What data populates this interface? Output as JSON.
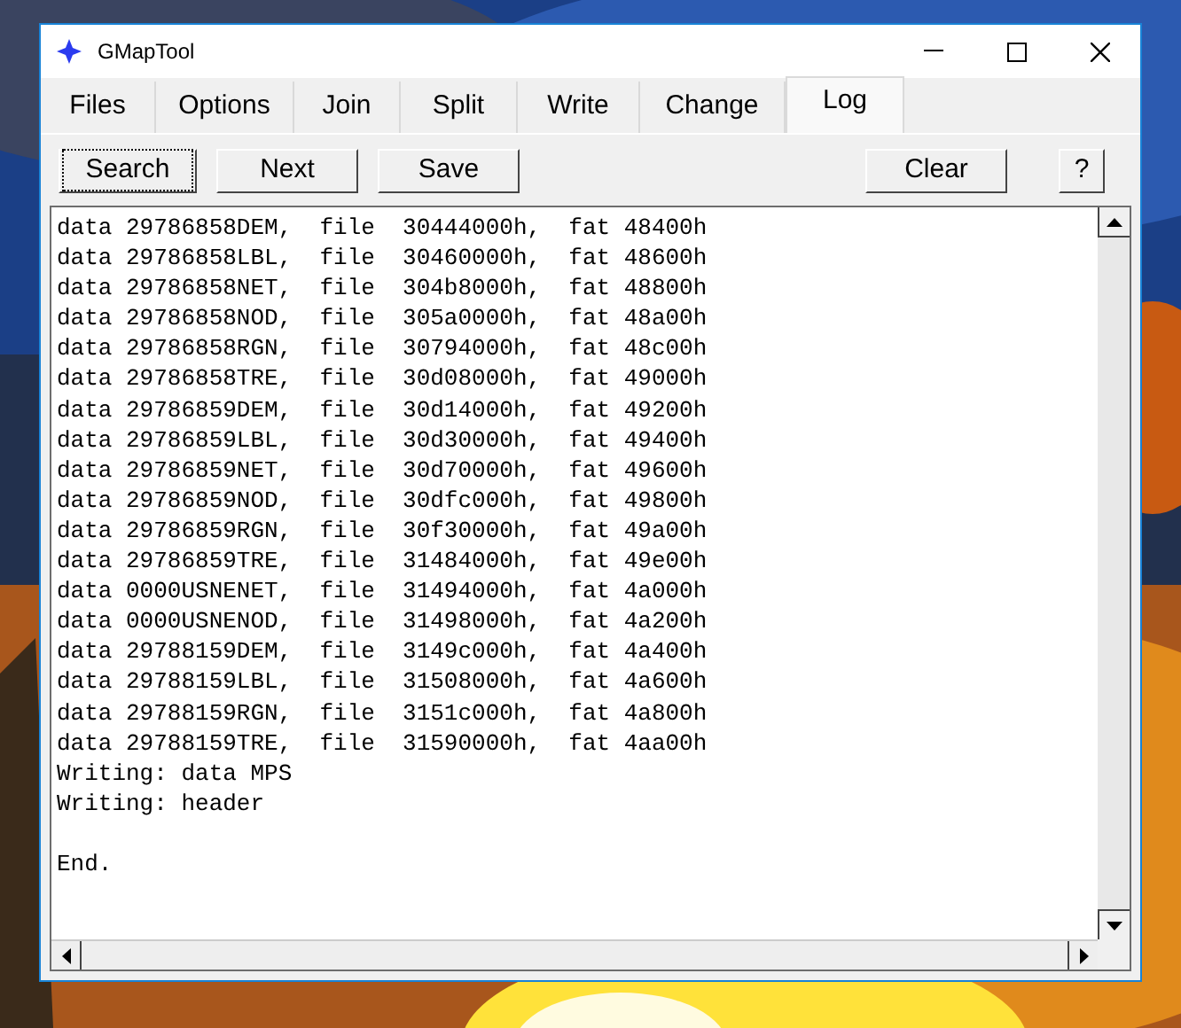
{
  "window": {
    "title": "GMapTool"
  },
  "tabs": [
    {
      "label": "Files",
      "selected": false
    },
    {
      "label": "Options",
      "selected": false
    },
    {
      "label": "Join",
      "selected": false
    },
    {
      "label": "Split",
      "selected": false
    },
    {
      "label": "Write",
      "selected": false
    },
    {
      "label": "Change",
      "selected": false
    },
    {
      "label": "Log",
      "selected": true
    }
  ],
  "toolbar": {
    "left_buttons": [
      {
        "label": "Search",
        "focused": true
      },
      {
        "label": "Next",
        "focused": false
      },
      {
        "label": "Save",
        "focused": false
      }
    ],
    "right_buttons": [
      {
        "label": "Clear",
        "focused": false
      },
      {
        "label": "?",
        "focused": false
      }
    ]
  },
  "log": {
    "lines": [
      {
        "text": "data 29786858DEM,  file  30444000h,  fat 48400h"
      },
      {
        "text": "data 29786858LBL,  file  30460000h,  fat 48600h"
      },
      {
        "text": "data 29786858NET,  file  304b8000h,  fat 48800h"
      },
      {
        "text": "data 29786858NOD,  file  305a0000h,  fat 48a00h"
      },
      {
        "text": "data 29786858RGN,  file  30794000h,  fat 48c00h"
      },
      {
        "text": "data 29786858TRE,  file  30d08000h,  fat 49000h"
      },
      {
        "text": "data 29786859DEM,  file  30d14000h,  fat 49200h"
      },
      {
        "text": "data 29786859LBL,  file  30d30000h,  fat 49400h"
      },
      {
        "text": "data 29786859NET,  file  30d70000h,  fat 49600h"
      },
      {
        "text": "data 29786859NOD,  file  30dfc000h,  fat 49800h"
      },
      {
        "text": "data 29786859RGN,  file  30f30000h,  fat 49a00h"
      },
      {
        "text": "data 29786859TRE,  file  31484000h,  fat 49e00h"
      },
      {
        "text": "data 0000USNENET,  file  31494000h,  fat 4a000h"
      },
      {
        "text": "data 0000USNENOD,  file  31498000h,  fat 4a200h"
      },
      {
        "text": "data 29788159DEM,  file  3149c000h,  fat 4a400h"
      },
      {
        "text": "data 29788159LBL,  file  31508000h,  fat 4a600h"
      },
      {
        "text": "data 29788159RGN,  file  3151c000h,  fat 4a800h"
      },
      {
        "text": "data 29788159TRE,  file  31590000h,  fat 4aa00h"
      },
      {
        "text": "Writing: data MPS"
      },
      {
        "text": "Writing: header"
      },
      {
        "kind": "blank"
      },
      {
        "text": "End."
      }
    ]
  }
}
